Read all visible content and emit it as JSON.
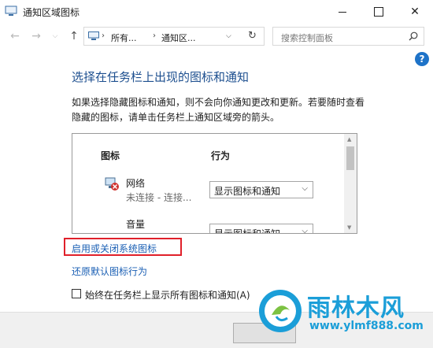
{
  "window": {
    "title": "通知区域图标",
    "minimize": "",
    "maximize": "",
    "close": "✕"
  },
  "nav": {
    "back": "←",
    "forward": "→",
    "recent": "⌵",
    "up": "↑",
    "breadcrumbs": [
      "所有...",
      "通知区..."
    ],
    "separator": "›",
    "dropdown": "⌵",
    "refresh": "↻",
    "search_placeholder": "搜索控制面板"
  },
  "help": "?",
  "main": {
    "heading": "选择在任务栏上出现的图标和通知",
    "description": "如果选择隐藏图标和通知，则不会向你通知更改和更新。若要随时查看隐藏的图标，请单击任务栏上通知区域旁的箭头。",
    "columns": {
      "icon": "图标",
      "behavior": "行为"
    },
    "rows": [
      {
        "name": "网络",
        "status": "未连接 - 连接...",
        "behavior": "显示图标和通知"
      },
      {
        "name": "音量",
        "status": "",
        "behavior": "显示图标和通知"
      }
    ],
    "link_toggle": "启用或关闭系统图标",
    "link_restore": "还原默认图标行为",
    "checkbox_label": "始终在任务栏上显示所有图标和通知(A)",
    "checkbox_checked": false
  },
  "watermark": {
    "brand": "雨林木风",
    "url": "www.ylmf888.com"
  },
  "colors": {
    "accent_link": "#1a5fb4",
    "heading": "#1d4f8f",
    "highlight": "#e0202a",
    "watermark": "#1b9ed8"
  }
}
